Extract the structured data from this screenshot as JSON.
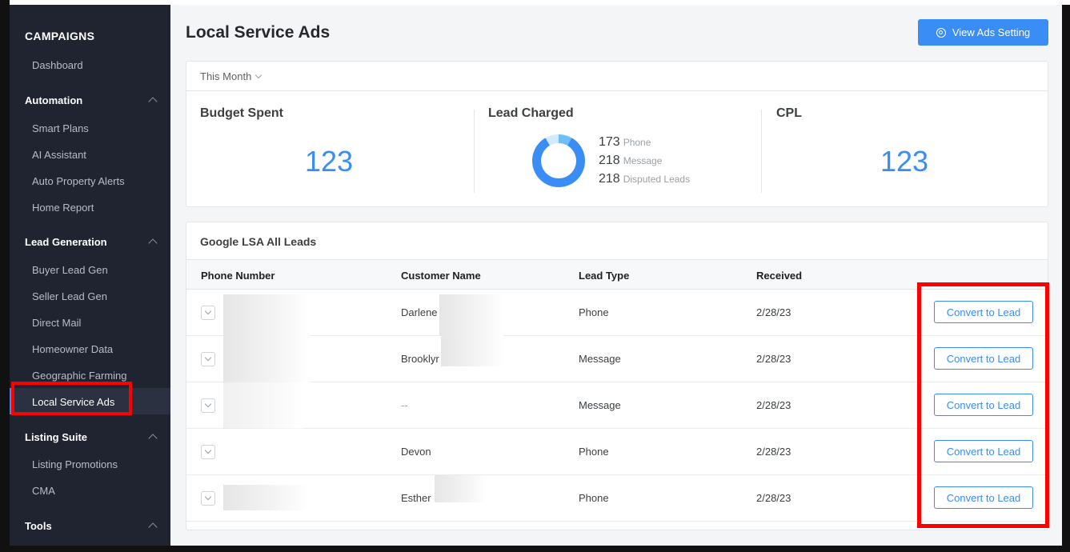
{
  "sidebar": {
    "heading": "CAMPAIGNS",
    "dashboard": "Dashboard",
    "sections": [
      {
        "label": "Automation",
        "items": [
          "Smart Plans",
          "AI Assistant",
          "Auto Property Alerts",
          "Home Report"
        ]
      },
      {
        "label": "Lead Generation",
        "items": [
          "Buyer Lead Gen",
          "Seller Lead Gen",
          "Direct Mail",
          "Homeowner Data",
          "Geographic Farming",
          "Local Service Ads"
        ]
      },
      {
        "label": "Listing Suite",
        "items": [
          "Listing Promotions",
          "CMA"
        ]
      },
      {
        "label": "Tools",
        "items": []
      }
    ],
    "active_item": "Local Service Ads"
  },
  "header": {
    "title": "Local Service Ads",
    "view_button": "View Ads Setting"
  },
  "summary": {
    "filter": "This Month",
    "budget_label": "Budget Spent",
    "budget_value": "123",
    "lead_label": "Lead Charged",
    "lead_legend": [
      {
        "value": "173",
        "label": "Phone"
      },
      {
        "value": "218",
        "label": "Message"
      },
      {
        "value": "218",
        "label": "Disputed Leads"
      }
    ],
    "cpl_label": "CPL",
    "cpl_value": "123"
  },
  "leads": {
    "title": "Google LSA All Leads",
    "columns": [
      "Phone Number",
      "Customer Name",
      "Lead Type",
      "Received"
    ],
    "rows": [
      {
        "name": "Darlene",
        "type": "Phone",
        "received": "2/28/23",
        "action": "Convert to Lead"
      },
      {
        "name": "Brooklyr",
        "type": "Message",
        "received": "2/28/23",
        "action": "Convert to Lead"
      },
      {
        "name": "--",
        "type": "Message",
        "received": "2/28/23",
        "action": "Convert to Lead"
      },
      {
        "name": "Devon",
        "type": "Phone",
        "received": "2/28/23",
        "action": "Convert to Lead"
      },
      {
        "name": "Esther",
        "type": "Phone",
        "received": "2/28/23",
        "action": "Convert to Lead"
      }
    ]
  },
  "colors": {
    "accent": "#3a8df5",
    "sidebar_bg": "#1f2430",
    "highlight": "#ff0000"
  }
}
